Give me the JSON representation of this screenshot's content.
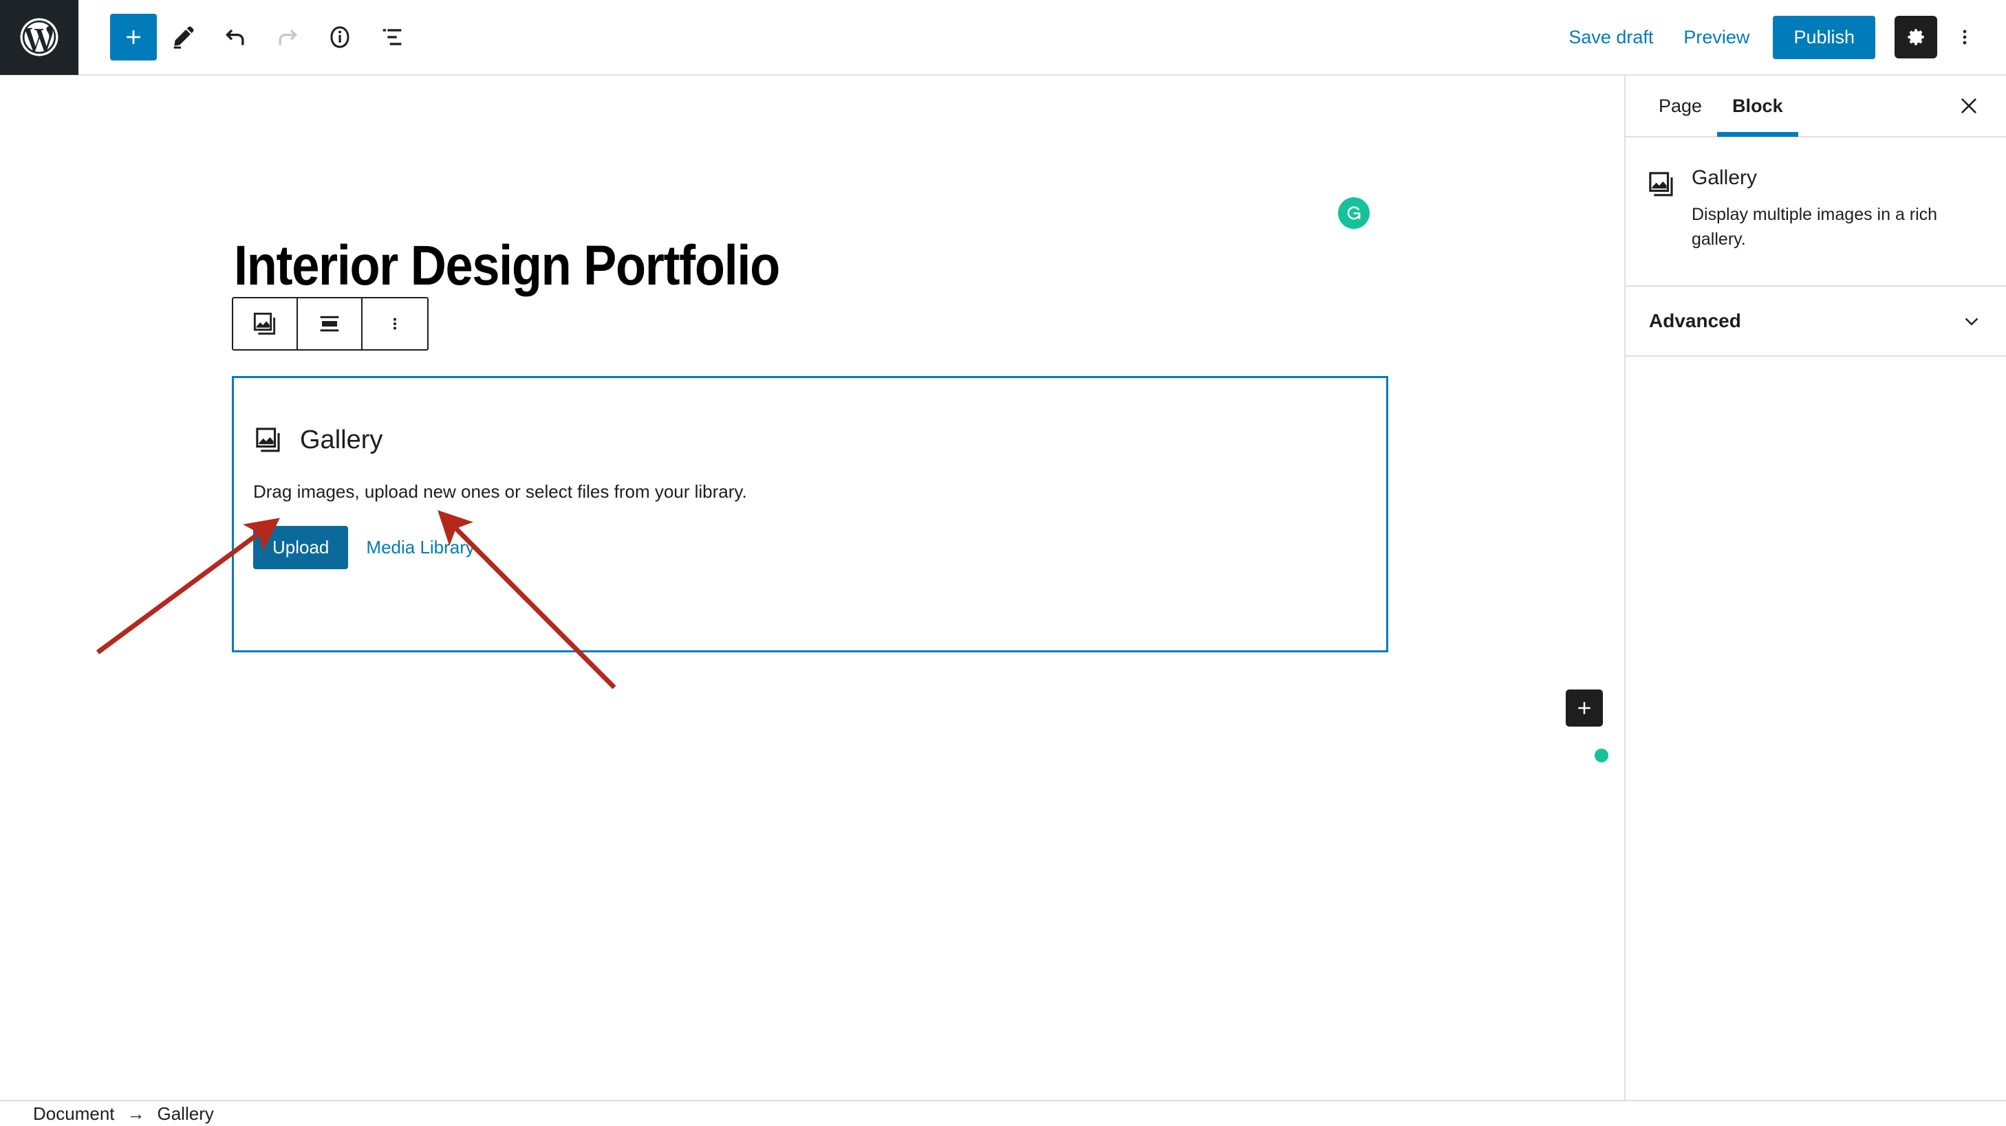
{
  "header": {
    "logo_name": "wordpress-logo",
    "tools": [
      {
        "name": "add-block-button",
        "icon": "plus-icon",
        "label": "Add block"
      },
      {
        "name": "edit-tool-button",
        "icon": "pencil-icon",
        "label": "Tools"
      },
      {
        "name": "undo-button",
        "icon": "undo-icon",
        "label": "Undo"
      },
      {
        "name": "redo-button",
        "icon": "redo-icon",
        "label": "Redo",
        "disabled": true
      },
      {
        "name": "details-button",
        "icon": "info-icon",
        "label": "Details"
      },
      {
        "name": "list-view-button",
        "icon": "list-view-icon",
        "label": "List view"
      }
    ],
    "save_draft_label": "Save draft",
    "preview_label": "Preview",
    "publish_label": "Publish",
    "settings_icon": "gear-icon",
    "more_icon": "kebab-menu-icon"
  },
  "editor": {
    "post_title": "Interior Design Portfolio",
    "block_toolbar": [
      {
        "name": "block-type-gallery-button",
        "icon": "gallery-icon"
      },
      {
        "name": "change-alignment-button",
        "icon": "align-icon"
      },
      {
        "name": "block-options-button",
        "icon": "kebab-menu-icon"
      }
    ],
    "gallery_block": {
      "title": "Gallery",
      "icon": "gallery-icon",
      "description": "Drag images, upload new ones or select files from your library.",
      "upload_label": "Upload",
      "media_library_label": "Media Library"
    },
    "grammarly_icon": "grammarly-g-icon",
    "rail_insert_icon": "plus-icon"
  },
  "sidebar": {
    "tabs": [
      {
        "label": "Page",
        "active": false,
        "name": "tab-page"
      },
      {
        "label": "Block",
        "active": true,
        "name": "tab-block"
      }
    ],
    "close_icon": "close-icon",
    "block_card": {
      "icon": "gallery-icon",
      "title": "Gallery",
      "description": "Display multiple images in a rich gallery."
    },
    "panels": [
      {
        "label": "Advanced",
        "name": "panel-advanced",
        "chevron": "chevron-down-icon"
      }
    ]
  },
  "footer": {
    "breadcrumb": [
      {
        "label": "Document",
        "name": "breadcrumb-document"
      },
      {
        "label": "Gallery",
        "name": "breadcrumb-gallery"
      }
    ],
    "separator": "→"
  },
  "colors": {
    "accent_blue": "#007cba",
    "upload_blue": "#0b6a9b",
    "dark": "#1e1e1e",
    "grammarly_green": "#15c39a",
    "annotation_red": "#b5281c"
  }
}
